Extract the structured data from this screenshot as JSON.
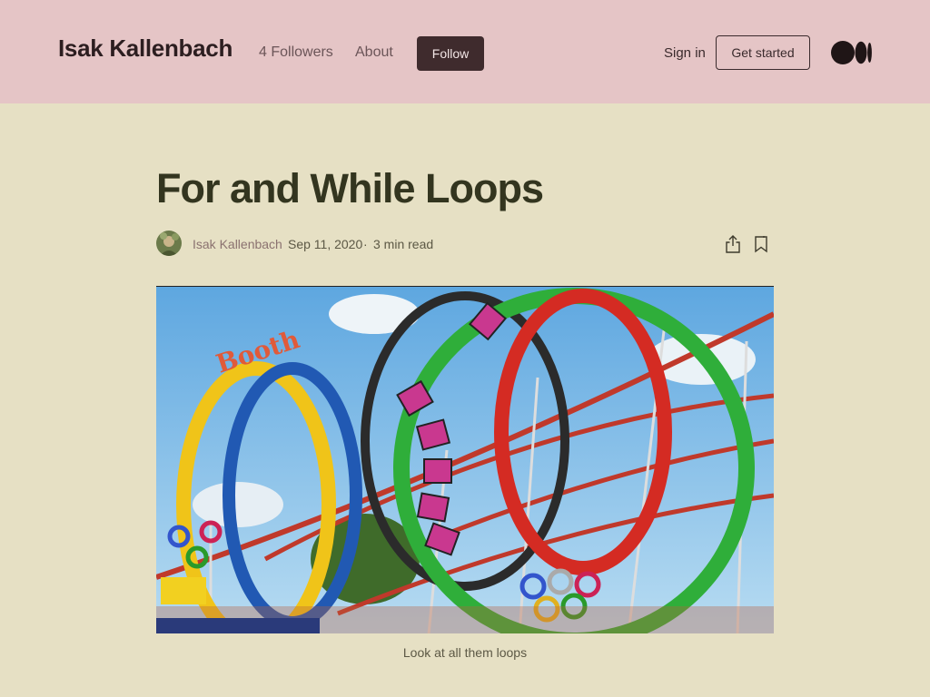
{
  "header": {
    "publication_name": "Isak Kallenbach",
    "followers": "4 Followers",
    "about": "About",
    "follow": "Follow",
    "sign_in": "Sign in",
    "get_started": "Get started",
    "logo_icon": "medium-logo-icon"
  },
  "article": {
    "title": "For and While Loops",
    "author": "Isak Kallenbach",
    "date": "Sep 11, 2020",
    "separator": "·",
    "read_time": "3 min read",
    "hero_image": "roller-coaster-loops-image",
    "caption": "Look at all them loops"
  },
  "colors": {
    "header_bg": "#e5c5c6",
    "page_bg": "#e6e0c4",
    "follow_button": "#3f2b2d",
    "title_text": "#33351f"
  }
}
